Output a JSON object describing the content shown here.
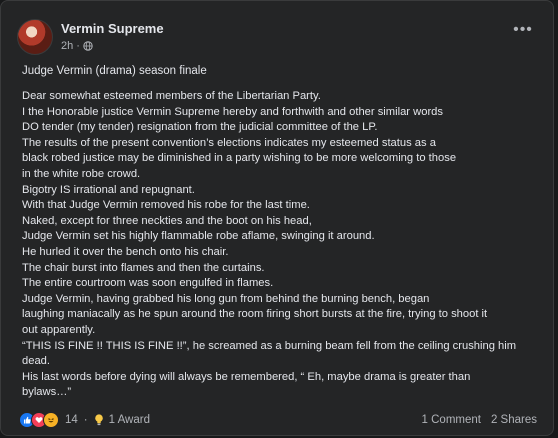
{
  "post": {
    "author": "Vermin Supreme",
    "time": "2h",
    "privacy_separator": "·",
    "title": "Judge Vermin (drama) season finale",
    "lines": [
      "Dear somewhat esteemed members of the Libertarian Party.",
      "I the Honorable justice Vermin Supreme hereby and forthwith and other similar words",
      "DO tender (my tender) resignation from the judicial committee of the LP.",
      "The results of the present convention’s elections indicates my esteemed status as a",
      "black robed justice may be diminished in a party wishing to be more welcoming to those",
      "in the white robe crowd.",
      "Bigotry IS irrational and repugnant.",
      "With that Judge Vermin removed his robe for the last time.",
      "Naked, except for  three neckties and the boot on his head,",
      "Judge Vermin set his highly flammable robe aflame, swinging it around.",
      "He hurled it over the bench onto his chair.",
      "The chair burst into flames and then the curtains.",
      "The entire courtroom was soon engulfed in flames.",
      "Judge Vermin, having grabbed his long gun from behind the burning bench, began",
      "laughing maniacally as he spun around the room firing short bursts at the fire, trying to shoot it",
      "out apparently.",
      "“THIS IS FINE !! THIS IS FINE !!”, he screamed as a burning beam fell from the ceiling crushing him",
      "dead.",
      "His last words before dying will always be remembered, “ Eh, maybe drama is greater than",
      "bylaws…”"
    ]
  },
  "footer": {
    "reaction_count": "14",
    "separator": "·",
    "award": "1 Award",
    "comments": "1 Comment",
    "shares": "2 Shares"
  },
  "icons": {
    "more": "more-options-icon",
    "privacy": "globe-icon",
    "award": "lightbulb-icon",
    "reactions": [
      "like-icon",
      "love-icon",
      "haha-icon"
    ]
  },
  "colors": {
    "background": "#18191a",
    "card": "#242526",
    "text": "#e4e6eb",
    "secondary_text": "#b0b3b8",
    "like": "#1877f2",
    "love": "#f33e58",
    "haha": "#f7b125"
  }
}
